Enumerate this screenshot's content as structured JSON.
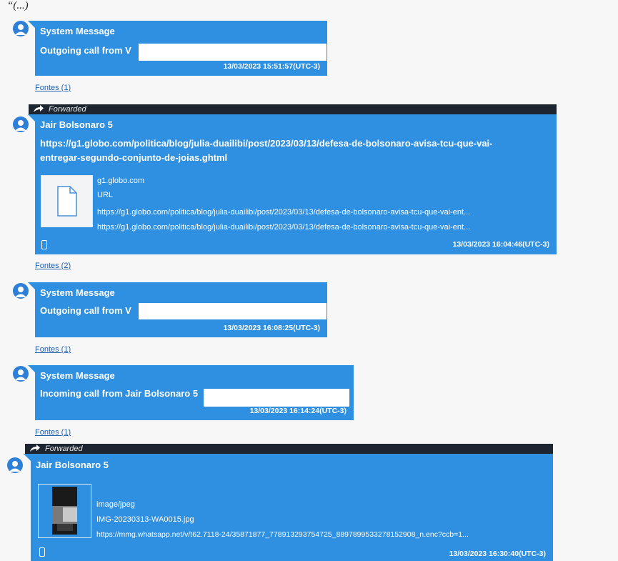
{
  "header": {
    "ellipsis": "“(...)"
  },
  "messages": [
    {
      "sender": "System Message",
      "text": "Outgoing call from V",
      "timestamp": "13/03/2023 15:51:57(UTC-3)",
      "sources": "Fontes (1)"
    },
    {
      "forwarded": "Forwarded",
      "sender": "Jair Bolsonaro 5",
      "text_line1": "https://g1.globo.com/politica/blog/julia-duailibi/post/2023/03/13/defesa-de-bolsonaro-avisa-tcu-que-vai-",
      "text_line2": "entregar-segundo-conjunto-de-joias.ghtml",
      "attachment": {
        "domain": "g1.globo.com",
        "type": "URL",
        "url1": "https://g1.globo.com/politica/blog/julia-duailibi/post/2023/03/13/defesa-de-bolsonaro-avisa-tcu-que-vai-ent...",
        "url2": "https://g1.globo.com/politica/blog/julia-duailibi/post/2023/03/13/defesa-de-bolsonaro-avisa-tcu-que-vai-ent..."
      },
      "timestamp": "13/03/2023 16:04:46(UTC-3)",
      "sources": "Fontes (2)"
    },
    {
      "sender": "System Message",
      "text": "Outgoing call from V",
      "timestamp": "13/03/2023 16:08:25(UTC-3)",
      "sources": "Fontes (1)"
    },
    {
      "sender": "System Message",
      "text": "Incoming call from Jair Bolsonaro 5",
      "timestamp": "13/03/2023 16:14:24(UTC-3)",
      "sources": "Fontes (1)"
    },
    {
      "forwarded": "Forwarded",
      "sender": "Jair Bolsonaro 5",
      "attachment": {
        "mime": "image/jpeg",
        "filename": "IMG-20230313-WA0015.jpg",
        "url": "https://mmg.whatsapp.net/v/t62.7118-24/35871877_778913293754725_8897899533278152908_n.enc?ccb=1..."
      },
      "timestamp": "13/03/2023 16:30:40(UTC-3)"
    }
  ],
  "colors": {
    "bubble": "#2f8fe0",
    "forward_bar": "#1c2530",
    "link": "#1f5fb0"
  }
}
